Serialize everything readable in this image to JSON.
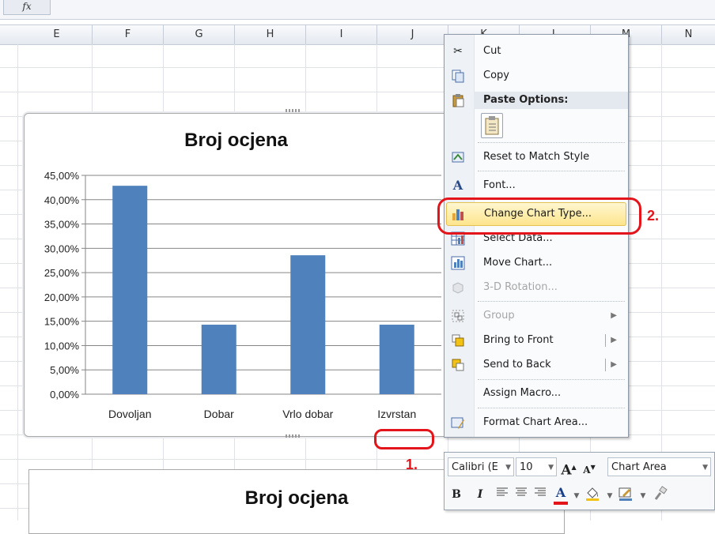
{
  "formula_bar": {
    "fx_label": "fx"
  },
  "columns": [
    {
      "label": "E"
    },
    {
      "label": "F"
    },
    {
      "label": "G"
    },
    {
      "label": "H"
    },
    {
      "label": "I"
    },
    {
      "label": "J"
    },
    {
      "label": "K"
    },
    {
      "label": "L"
    },
    {
      "label": "M"
    },
    {
      "label": "N"
    }
  ],
  "chart_data": [
    {
      "type": "bar",
      "title": "Broj ocjena",
      "categories": [
        "Dovoljan",
        "Dobar",
        "Vrlo dobar",
        "Izvrstan"
      ],
      "values": [
        42.86,
        14.29,
        28.57,
        14.29
      ],
      "y_ticks": [
        "0,00%",
        "5,00%",
        "10,00%",
        "15,00%",
        "20,00%",
        "25,00%",
        "30,00%",
        "35,00%",
        "40,00%",
        "45,00%"
      ],
      "ylim": [
        0,
        45
      ],
      "grid": true,
      "color": "#4f81bd"
    },
    {
      "type": "bar",
      "title": "Broj ocjena"
    }
  ],
  "annotations": {
    "step1": "1.",
    "step2": "2."
  },
  "context_menu": {
    "items": [
      {
        "label": "Cut",
        "icon": "scissors-icon"
      },
      {
        "label": "Copy",
        "icon": "copy-icon"
      },
      {
        "label": "Paste Options:",
        "icon": "paste-icon"
      },
      {
        "label": "Reset to Match Style",
        "icon": "reset-style-icon"
      },
      {
        "label": "Font...",
        "icon": "font-icon"
      },
      {
        "label": "Change Chart Type...",
        "icon": "chart-type-icon",
        "highlighted": true
      },
      {
        "label": "Select Data...",
        "icon": "select-data-icon"
      },
      {
        "label": "Move Chart...",
        "icon": "move-chart-icon"
      },
      {
        "label": "3-D Rotation...",
        "icon": "rotation-icon",
        "disabled": true
      },
      {
        "label": "Group",
        "icon": "group-icon",
        "disabled": true
      },
      {
        "label": "Bring to Front",
        "icon": "bring-front-icon"
      },
      {
        "label": "Send to Back",
        "icon": "send-back-icon"
      },
      {
        "label": "Assign Macro..."
      },
      {
        "label": "Format Chart Area...",
        "icon": "format-area-icon"
      }
    ]
  },
  "mini_toolbar": {
    "font_name": "Calibri (E",
    "font_size": "10",
    "element_select": "Chart Area",
    "bold": "B",
    "italic": "I",
    "grow_font": "A",
    "shrink_font": "A",
    "font_color_letter": "A",
    "colors": {
      "font_color": "#e3141a",
      "fill_color": "#f2c314"
    }
  },
  "colors": {
    "annotation_red": "#e3141a",
    "bar_blue": "#4f81bd"
  }
}
